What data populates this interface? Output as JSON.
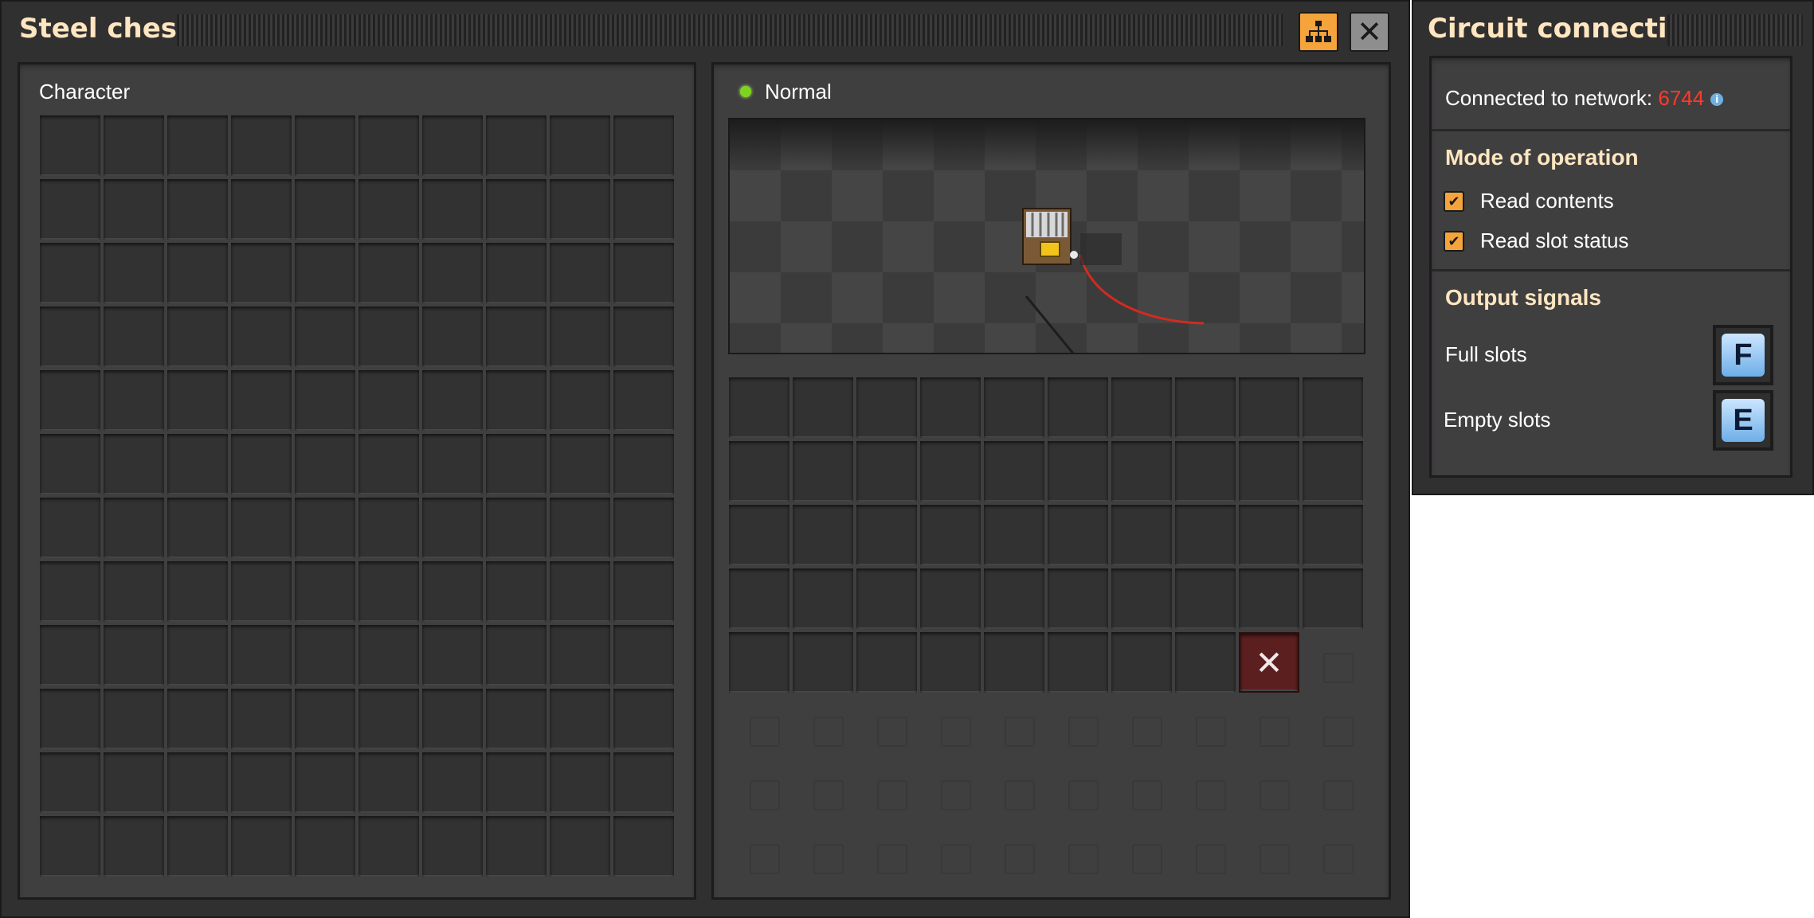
{
  "chest_window": {
    "title": "Steel chest",
    "circuit_button_icon": "circuit-network-icon",
    "close_icon": "close-icon",
    "close_symbol": "✕"
  },
  "character_panel": {
    "label": "Character",
    "columns": 10,
    "rows": 12
  },
  "entity_panel": {
    "status": "Normal",
    "status_color": "#7ed321",
    "inventory_slots": 48,
    "filter_slot_symbol": "✕",
    "filter_slot_color": "#5c1f1f"
  },
  "circuit_window": {
    "title": "Circuit connection",
    "connected_label": "Connected to network:",
    "network_id": "6744",
    "network_id_color": "#ff3a2a",
    "mode_title": "Mode of operation",
    "mode_options": [
      {
        "label": "Read contents",
        "checked": true
      },
      {
        "label": "Read slot status",
        "checked": true
      }
    ],
    "output_title": "Output signals",
    "signals": [
      {
        "label": "Full slots",
        "signal": "F"
      },
      {
        "label": "Empty slots",
        "signal": "E"
      }
    ]
  },
  "colors": {
    "accent": "#f5a43b",
    "title_text": "#ffe6c0",
    "panel_bg": "#403f40",
    "window_bg": "#313031"
  }
}
